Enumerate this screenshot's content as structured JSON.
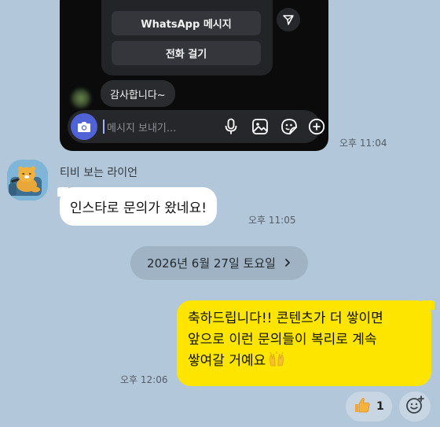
{
  "screenshot": {
    "button_whatsapp": "WhatsApp 메시지",
    "button_call": "전화 걸기",
    "thanks_message": "감사합니다~",
    "input_placeholder": "메시지 보내기...",
    "icons": [
      "send-icon",
      "camera-icon",
      "microphone-icon",
      "gallery-icon",
      "sticker-icon",
      "plus-icon"
    ]
  },
  "chat": {
    "image_time": "오후 11:04",
    "sender_name": "티비 보는 라이언",
    "incoming_message": "인스타로 문의가 왔네요!",
    "incoming_time": "오후 11:05",
    "date_separator": "2026년 6월 27일 토요일",
    "outgoing_lines": [
      "축하드립니다!! 콘텐츠가 더 쌓이면",
      "앞으로 이런 문의들이 복리로 계속",
      "쌓여갈 거예요"
    ],
    "outgoing_time": "오후 12:06",
    "reaction_count": "1"
  },
  "colors": {
    "chat_background": "#b2c7da",
    "outgoing_bubble": "#fee500",
    "incoming_bubble": "#ffffff",
    "camera_button": "#4f62d6"
  }
}
